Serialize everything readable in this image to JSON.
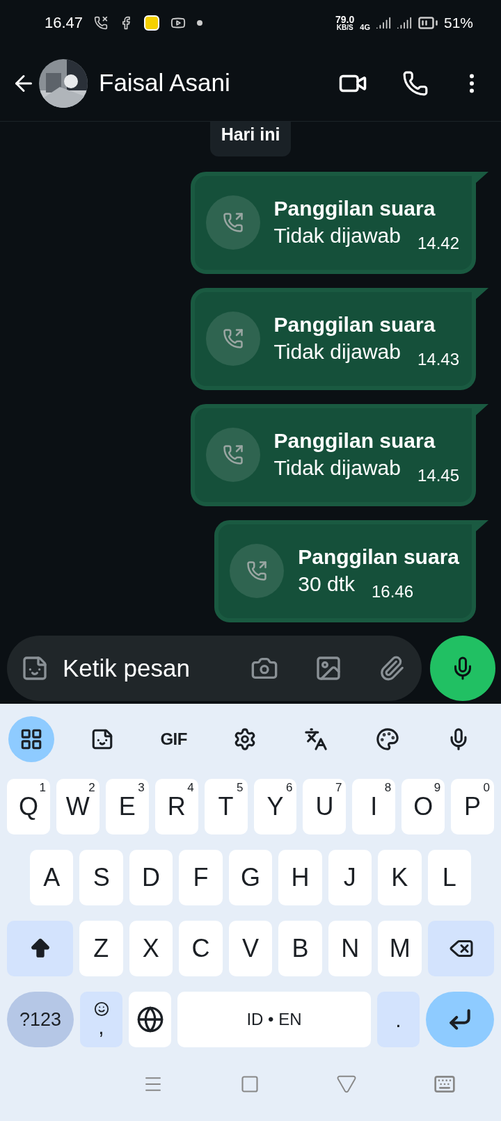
{
  "status_bar": {
    "time": "16.47",
    "speed": "79.0",
    "speed_unit": "KB/S",
    "network": "4G",
    "battery": "51%"
  },
  "header": {
    "contact_name": "Faisal Asani"
  },
  "date_chip": "Hari ini",
  "messages": [
    {
      "title": "Panggilan suara",
      "subtitle": "Tidak dijawab",
      "time": "14.42"
    },
    {
      "title": "Panggilan suara",
      "subtitle": "Tidak dijawab",
      "time": "14.43"
    },
    {
      "title": "Panggilan suara",
      "subtitle": "Tidak dijawab",
      "time": "14.45"
    },
    {
      "title": "Panggilan suara",
      "subtitle": "30 dtk",
      "time": "16.46"
    }
  ],
  "composer": {
    "placeholder": "Ketik pesan"
  },
  "keyboard": {
    "toolbar": [
      {
        "kind": "apps",
        "selected": true
      },
      {
        "kind": "sticker",
        "selected": false
      },
      {
        "kind": "gif",
        "label": "GIF",
        "selected": false
      },
      {
        "kind": "settings",
        "selected": false
      },
      {
        "kind": "translate",
        "selected": false
      },
      {
        "kind": "theme",
        "selected": false
      },
      {
        "kind": "voice",
        "selected": false
      }
    ],
    "rows": [
      [
        {
          "kind": "letter",
          "label": "Q",
          "hint": "1"
        },
        {
          "kind": "letter",
          "label": "W",
          "hint": "2"
        },
        {
          "kind": "letter",
          "label": "E",
          "hint": "3"
        },
        {
          "kind": "letter",
          "label": "R",
          "hint": "4"
        },
        {
          "kind": "letter",
          "label": "T",
          "hint": "5"
        },
        {
          "kind": "letter",
          "label": "Y",
          "hint": "6"
        },
        {
          "kind": "letter",
          "label": "U",
          "hint": "7"
        },
        {
          "kind": "letter",
          "label": "I",
          "hint": "8"
        },
        {
          "kind": "letter",
          "label": "O",
          "hint": "9"
        },
        {
          "kind": "letter",
          "label": "P",
          "hint": "0"
        }
      ],
      [
        {
          "kind": "letter",
          "label": "A"
        },
        {
          "kind": "letter",
          "label": "S"
        },
        {
          "kind": "letter",
          "label": "D"
        },
        {
          "kind": "letter",
          "label": "F"
        },
        {
          "kind": "letter",
          "label": "G"
        },
        {
          "kind": "letter",
          "label": "H"
        },
        {
          "kind": "letter",
          "label": "J"
        },
        {
          "kind": "letter",
          "label": "K"
        },
        {
          "kind": "letter",
          "label": "L"
        }
      ],
      [
        {
          "kind": "shift"
        },
        {
          "kind": "letter",
          "label": "Z"
        },
        {
          "kind": "letter",
          "label": "X"
        },
        {
          "kind": "letter",
          "label": "C"
        },
        {
          "kind": "letter",
          "label": "V"
        },
        {
          "kind": "letter",
          "label": "B"
        },
        {
          "kind": "letter",
          "label": "N"
        },
        {
          "kind": "letter",
          "label": "M"
        },
        {
          "kind": "backspace"
        }
      ]
    ],
    "bottom_row": [
      {
        "kind": "symbols",
        "label": "?123"
      },
      {
        "kind": "emoji_comma",
        "label": ","
      },
      {
        "kind": "globe"
      },
      {
        "kind": "space",
        "label": "ID • EN"
      },
      {
        "kind": "period",
        "label": "."
      },
      {
        "kind": "enter"
      }
    ]
  }
}
